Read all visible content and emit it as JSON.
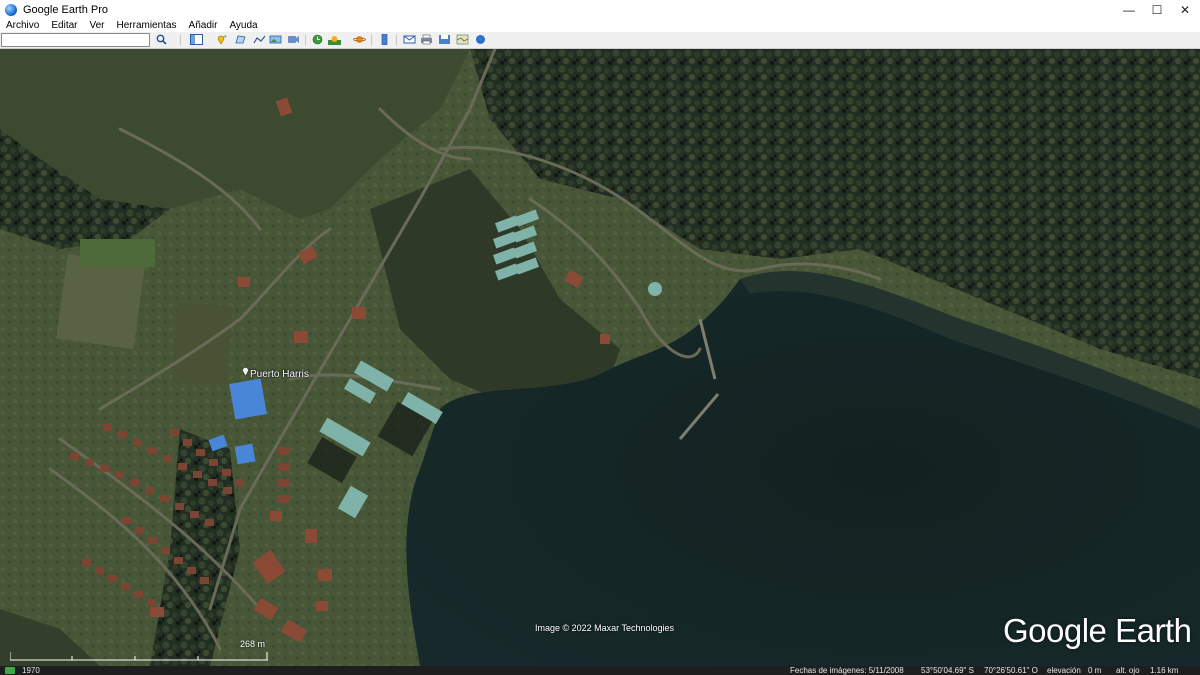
{
  "window": {
    "title": "Google Earth Pro",
    "minimize_glyph": "—",
    "maximize_glyph": "☐",
    "close_glyph": "✕"
  },
  "menu": [
    "Archivo",
    "Editar",
    "Ver",
    "Herramientas",
    "Añadir",
    "Ayuda"
  ],
  "search": {
    "value": "",
    "placeholder": ""
  },
  "toolbar_icons": [
    "search-icon",
    "sidebar-toggle-icon",
    "add-placemark-icon",
    "add-polygon-icon",
    "add-path-icon",
    "add-image-overlay-icon",
    "record-tour-icon",
    "historical-imagery-icon",
    "sunlight-icon",
    "planets-icon",
    "ruler-icon",
    "email-icon",
    "print-icon",
    "save-image-icon",
    "view-in-maps-icon",
    "earth-icon"
  ],
  "map": {
    "place_label": "Puerto Harris",
    "attribution": "Image © 2022 Maxar Technologies",
    "logo": "Google Earth",
    "scale_label": "268 m"
  },
  "status": {
    "year": "1970",
    "imagery_date": "Fechas de imágenes: 5/11/2008",
    "lat": "53°50'04.69\" S",
    "lon": "70°26'50.61\" O",
    "elevation": "elevación",
    "elevation_value": "0 m",
    "eye_alt": "alt. ojo",
    "eye_alt_value": "1.16 km"
  },
  "colors": {
    "water": "#13211f",
    "forest": "#1f2c1e",
    "grass": "#4a5a3a",
    "roof_red": "#8a4a35",
    "roof_blue": "#4a86d8",
    "roof_teal": "#7fb2a8"
  }
}
